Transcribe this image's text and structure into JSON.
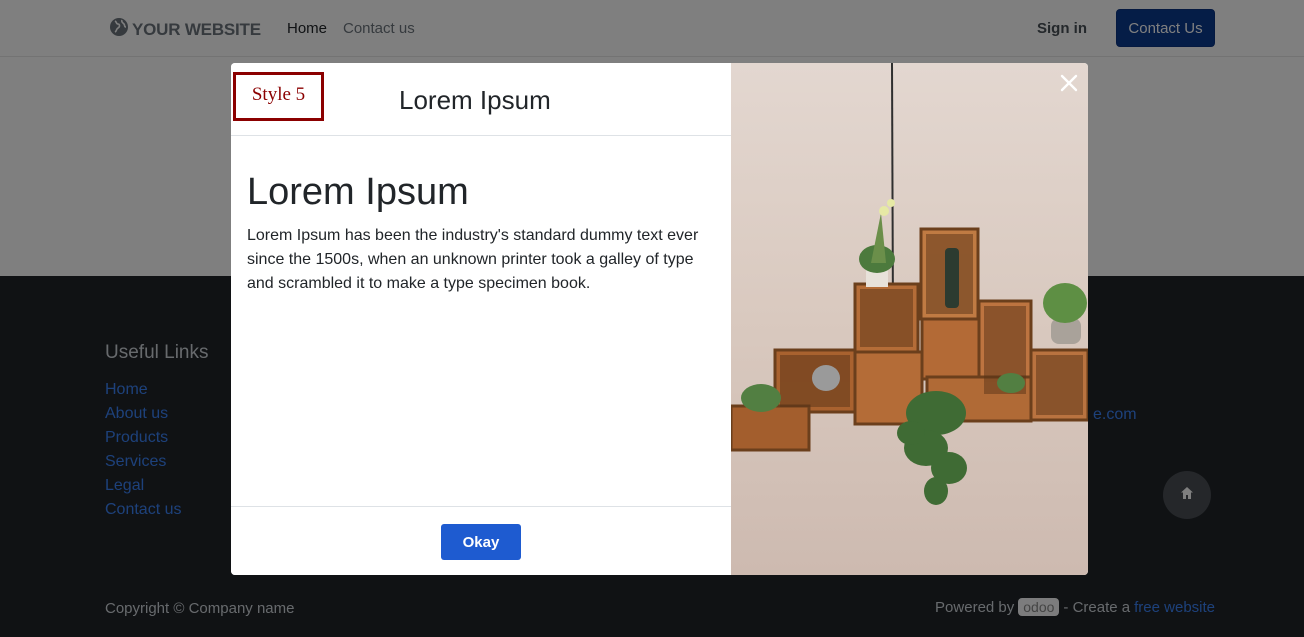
{
  "navbar": {
    "brand": "YOUR WEBSITE",
    "links": [
      "Home",
      "Contact us"
    ],
    "signin_label": "Sign in",
    "cta_label": "Contact Us"
  },
  "footer": {
    "useful_links_title": "Useful Links",
    "links": [
      "Home",
      "About us",
      "Products",
      "Services",
      "Legal",
      "Contact us"
    ],
    "email_fragment": "e.com",
    "copyright": "Copyright © Company name",
    "powered_by": "Powered by",
    "odoo_badge": "odoo",
    "create_a": "- Create a",
    "free_website": "free website"
  },
  "modal": {
    "style_tag": "Style 5",
    "title": "Lorem Ipsum",
    "body_heading": "Lorem Ipsum",
    "body_text": "Lorem Ipsum has been the industry's standard dummy text ever since the 1500s, when an unknown printer took a galley of type and scrambled it to make a type specimen book.",
    "okay_label": "Okay"
  },
  "colors": {
    "primary": "#0b3a8f",
    "okay_button": "#1e5bd0",
    "style_tag_border": "#8b0000",
    "footer_bg": "#212529",
    "link": "#3b82f6"
  },
  "icons": {
    "brand": "globe-icon",
    "close": "close-icon",
    "home": "home-icon"
  }
}
